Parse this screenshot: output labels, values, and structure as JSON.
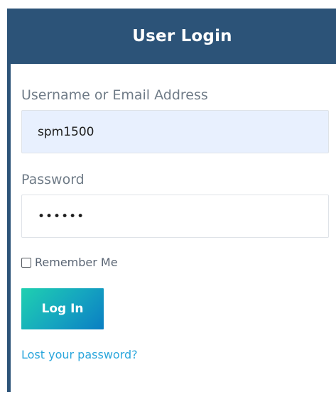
{
  "widget": {
    "title": "User Login"
  },
  "form": {
    "username_label": "Username or Email Address",
    "username_value": "spm1500",
    "password_label": "Password",
    "password_value": "••••••",
    "remember_label": "Remember Me",
    "remember_checked": false,
    "submit_label": "Log In",
    "lost_password_label": "Lost your password?"
  },
  "colors": {
    "header_bg": "#2c5378",
    "input_autofill_bg": "#e8f0fe",
    "button_gradient_start": "#1fd0b0",
    "button_gradient_end": "#0a7ec3",
    "link": "#2aa6dc"
  },
  "icons": {
    "remember": "checkbox-unchecked-icon"
  }
}
